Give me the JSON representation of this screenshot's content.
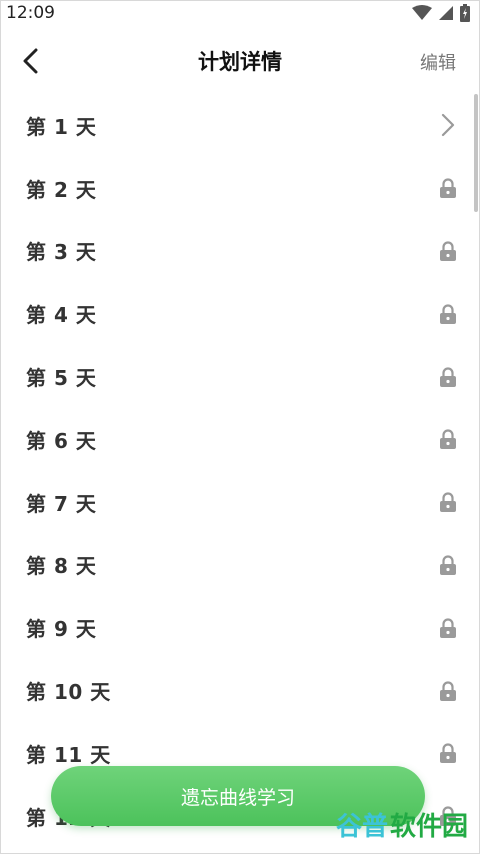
{
  "status_bar": {
    "time": "12:09"
  },
  "header": {
    "title": "计划详情",
    "edit_label": "编辑"
  },
  "days": [
    {
      "label": "第 1 天",
      "state": "open"
    },
    {
      "label": "第 2 天",
      "state": "locked"
    },
    {
      "label": "第 3 天",
      "state": "locked"
    },
    {
      "label": "第 4 天",
      "state": "locked"
    },
    {
      "label": "第 5 天",
      "state": "locked"
    },
    {
      "label": "第 6 天",
      "state": "locked"
    },
    {
      "label": "第 7 天",
      "state": "locked"
    },
    {
      "label": "第 8 天",
      "state": "locked"
    },
    {
      "label": "第 9 天",
      "state": "locked"
    },
    {
      "label": "第 10 天",
      "state": "locked"
    },
    {
      "label": "第 11 天",
      "state": "locked"
    },
    {
      "label": "第 12 天",
      "state": "locked"
    }
  ],
  "study_button": {
    "label": "遗忘曲线学习"
  },
  "watermark": {
    "part1": "谷普",
    "part2": "软件园"
  },
  "colors": {
    "accent_green": "#52c55f",
    "icon_gray": "#9a9a9a"
  }
}
